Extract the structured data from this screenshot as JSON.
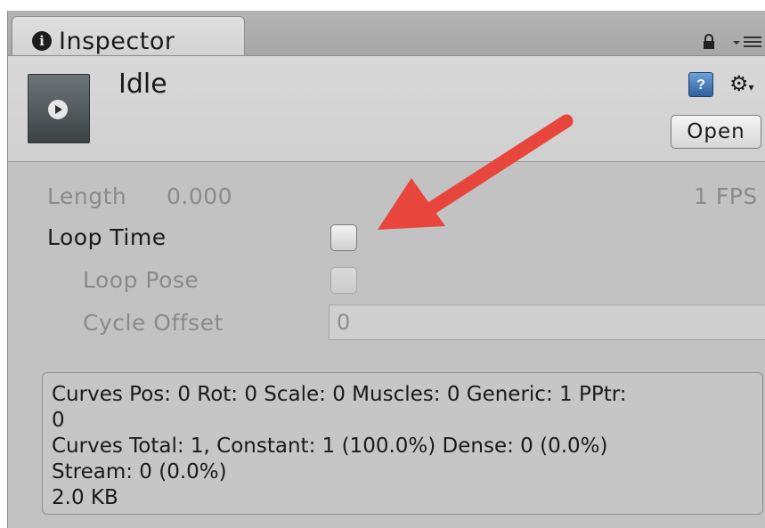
{
  "window": {
    "tab_title": "Inspector",
    "icons": [
      "info-icon",
      "lock-icon",
      "context-menu-icon"
    ]
  },
  "header": {
    "clip_name": "Idle",
    "book_icon_glyph": "?",
    "open_label": "Open"
  },
  "properties": {
    "length_label": "Length",
    "length_value": "0.000",
    "fps": "1 FPS",
    "loop_time_label": "Loop Time",
    "loop_time_checked": false,
    "loop_pose_label": "Loop Pose",
    "loop_pose_checked": false,
    "cycle_offset_label": "Cycle Offset",
    "cycle_offset_value": "0"
  },
  "info": {
    "line1": "Curves Pos: 0 Rot: 0 Scale: 0 Muscles: 0 Generic: 1 PPtr:",
    "line2": "0",
    "line3": "Curves Total: 1, Constant: 1 (100.0%) Dense: 0 (0.0%)",
    "line4": "Stream: 0 (0.0%)",
    "line5": "2.0 KB"
  },
  "annotation": {
    "arrow_color": "#e8453c",
    "points_to": "loop-time-checkbox"
  },
  "colors": {
    "panel_bg": "#c2c2c2",
    "tab_bg": "#d8d8d8",
    "disabled_text": "#8a8a8a"
  }
}
